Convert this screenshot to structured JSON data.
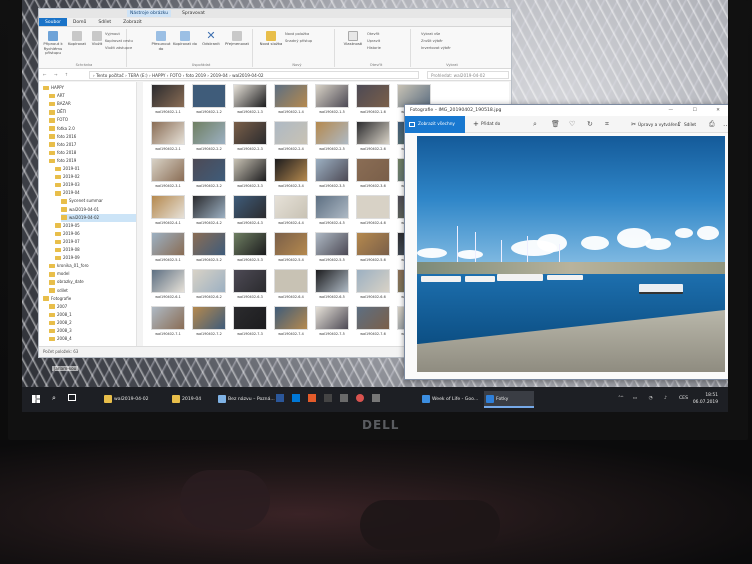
{
  "explorer": {
    "title_tab": "Nástroje obrázku",
    "title_tab2": "Spravovat",
    "ribbon_tabs": [
      "Soubor",
      "Domů",
      "Sdílet",
      "Zobrazit"
    ],
    "ribbon": {
      "pin": "Připnout k Rychlému přístupu",
      "copy": "Kopírovat",
      "paste": "Vložit",
      "cut": "Vyjmout",
      "copy_path": "Kopírovat cestu",
      "paste_shortcut": "Vložit zástupce",
      "group_clipboard": "Schránka",
      "move_to": "Přesunout do",
      "copy_to": "Kopírovat do",
      "delete": "Odstranit",
      "rename": "Přejmenovat",
      "group_organize": "Uspořádat",
      "new_folder": "Nová složka",
      "new_item": "Nová položka",
      "easy_access": "Snadný přístup",
      "group_new": "Nový",
      "properties": "Vlastnosti",
      "open": "Otevřít",
      "edit": "Upravit",
      "history": "Historie",
      "group_open": "Otevřít",
      "select_all": "Vybrat vše",
      "select_none": "Zrušit výběr",
      "invert_selection": "Invertovat výběr",
      "group_select": "Vybrat"
    },
    "address": {
      "nav": "← → ↑",
      "path": "› Tento počítač › TERA (E:) › HAPPY › FOTO › foto 2019 › 2019-04 › wal2019-04-02",
      "search_placeholder": "Prohledat: wal2019-04-02"
    },
    "nav_items": [
      "HAPPY",
      "ART",
      "BAZAR",
      "DĚTI",
      "FOTO",
      "fotka 2.0",
      "foto 2016",
      "foto 2017",
      "foto 2018",
      "foto 2019",
      "2019-01",
      "2019-02",
      "2019-03",
      "2019-04",
      "Sycenet summar",
      "wal2019-04-01",
      "wal2019-04-02",
      "2019-05",
      "2019-06",
      "2019-07",
      "2019-08",
      "2019-09",
      "kronika_01_foro",
      "model",
      "obrazky_date",
      "sdílet",
      "Fotografie",
      "2007",
      "2008_1",
      "2008_2",
      "2008_3",
      "2008_4"
    ],
    "thumbnails": [
      "wal190402-1-1",
      "wal190402-1-2",
      "wal190402-1-3",
      "wal190402-1-4",
      "wal190402-1-5",
      "wal190402-1-6",
      "wal190402-1-7",
      "wal190402-2-1",
      "wal190402-2-2",
      "wal190402-2-3",
      "wal190402-2-4",
      "wal190402-2-5",
      "wal190402-2-6",
      "wal190402-2-7",
      "wal190402-3-1",
      "wal190402-3-2",
      "wal190402-3-3",
      "wal190402-3-4",
      "wal190402-3-5",
      "wal190402-3-6",
      "wal190402-3-7",
      "wal190402-4-1",
      "wal190402-4-2",
      "wal190402-4-3",
      "wal190402-4-4",
      "wal190402-4-5",
      "wal190402-4-6",
      "wal190402-4-7",
      "wal190402-5-1",
      "wal190402-5-2",
      "wal190402-5-3",
      "wal190402-5-4",
      "wal190402-5-5",
      "wal190402-5-6",
      "wal190402-5-7",
      "wal190402-6-1",
      "wal190402-6-2",
      "wal190402-6-3",
      "wal190402-6-4",
      "wal190402-6-5",
      "wal190402-6-6",
      "wal190402-6-7",
      "wal190402-7-1",
      "wal190402-7-2",
      "wal190402-7-3",
      "wal190402-7-4",
      "wal190402-7-5",
      "wal190402-7-6",
      "wal190402-7-7"
    ],
    "status": "Počet položek: 63"
  },
  "photos": {
    "title": "Fotografie – IMG_20190402_190518.jpg",
    "see_all": "Zobrazit všechny fotky",
    "add_to": "Přidat do",
    "edit_create": "Úpravy a vytváření",
    "share": "Sdílet",
    "window_buttons": "— ☐ ✕"
  },
  "taskbar": {
    "apps": [
      {
        "label": "wal2019-04-02",
        "color": "#e8be4a"
      },
      {
        "label": "2019-04",
        "color": "#e8be4a"
      },
      {
        "label": "Bez názvu – Pozná...",
        "color": "#7fb2e5"
      },
      {
        "label": "Week of Life - Goo...",
        "color": "#3c8ee0"
      },
      {
        "label": "Fotky",
        "color": "#2f7fd8"
      }
    ],
    "tray": "⌃ ▭ ◔ ♪",
    "lang": "CES",
    "time": "18:51",
    "date": "06.07.2019"
  },
  "desktop_label": "Jarlam-kou",
  "bezel_logo": "DELL"
}
